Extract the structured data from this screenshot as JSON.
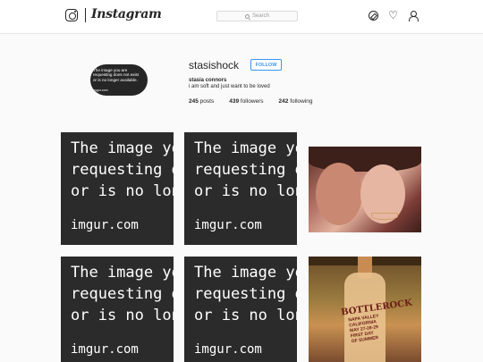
{
  "header": {
    "logo": "instagram-camera-icon",
    "wordmark": "Instagram",
    "search": {
      "placeholder": "Search",
      "icon": "search-icon"
    },
    "nav_icons": [
      "compass-icon",
      "heart-icon",
      "user-icon"
    ]
  },
  "profile": {
    "avatar_lines": [
      "The image you are",
      "requesting does not exist",
      "or is no longer available."
    ],
    "avatar_url": "imgur.com",
    "username": "stasishock",
    "follow_label": "FOLLOW",
    "full_name": "stasia connors",
    "bio": "i am soft and just want to be loved",
    "stats": {
      "posts_count": "245",
      "posts_label": "posts",
      "followers_count": "439",
      "followers_label": "followers",
      "following_count": "242",
      "following_label": "following"
    }
  },
  "grid": {
    "broken_text": {
      "line1": "The image yo",
      "line2": "requesting d",
      "line3": "or is no longe",
      "url": "imgur.com"
    },
    "poster_text": {
      "title": "BOTTLEROCK",
      "sub1": "NAPA VALLEY",
      "sub2": "CALIFORNIA",
      "sub3": "MAY 27-28-29",
      "sub4": "FIRST DAY",
      "sub5": "OF SUMMER"
    }
  },
  "colors": {
    "accent": "#3897f0",
    "border": "#dbdbdb",
    "background": "#fafafa"
  }
}
